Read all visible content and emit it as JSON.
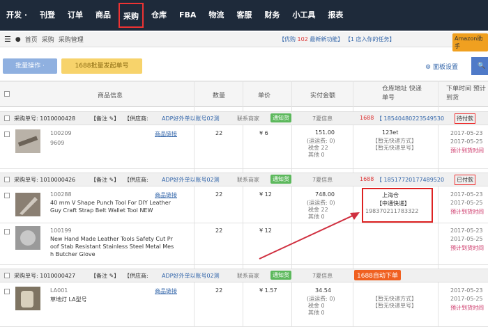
{
  "nav": {
    "items": [
      "开发 ·",
      "刊登",
      "订单",
      "商品",
      "采购",
      "仓库",
      "FBA",
      "物流",
      "客服",
      "财务",
      "小工具",
      "报表"
    ],
    "active": 4
  },
  "crumbs": [
    "首页",
    "采购",
    "采购管理"
  ],
  "notice": {
    "prefix": "【优购",
    "count": "102",
    "suffix": "最新新功能】 【1 店入你的任务】"
  },
  "amazon": "Amazon助手",
  "toolbar": {
    "batch": "批量操作 ·",
    "yellow": "1688批量发起单号",
    "settings": "面板设置"
  },
  "table": {
    "headers": [
      "商品信息",
      "数量",
      "单价",
      "实付金额",
      "仓库地址 快递单号",
      "下单时间 预计到货"
    ]
  },
  "orders": [
    {
      "po": "采购单号: 1010000428",
      "remark": "【备注 ✎】",
      "supplier": "【供应商: ",
      "supplier_name": "ADP好外单以账号02测",
      "contact": "联系商家",
      "label": "通知货",
      "price_label": "7夏信息",
      "src": "1688",
      "tracking": "【 18540480223549530",
      "status": "待付款"
    },
    {
      "po": "采购单号: 1010000426",
      "remark": "【备注 ✎】",
      "supplier": "【供应商: ",
      "supplier_name": "ADP好外单以账号02测",
      "contact": "联系商家",
      "label": "通知货",
      "price_label": "7夏信息",
      "src": "1688",
      "tracking": "【 18517720177489520",
      "status": "已付款"
    },
    {
      "po": "采购单号: 1010000427",
      "remark": "【备注 ✎】",
      "supplier": "【供应商: ",
      "supplier_name": "ADP好外单以账号02测",
      "contact": "联系商家",
      "label": "通知货",
      "price_label": "7夏信息",
      "orange": "1688自动下单"
    }
  ],
  "items": [
    {
      "sku": "100209",
      "name": "9609",
      "link": "商品链接",
      "qty": "22",
      "price": "¥ 6",
      "total": "151.00",
      "ship": "(运运费: 0)",
      "tax": "税金 22",
      "other": "其他 0",
      "addr": "123et",
      "addr2": "【暂无快递方式】",
      "addr3": "【暂无快递单号】",
      "date": "2017-05-23",
      "date2": "2017-05-25",
      "date3": "预计到货时间"
    },
    {
      "sku": "100288",
      "name": "40 mm V Shape Punch Tool For DIY Leather",
      "name2": "Guy Craft Strap Belt Wallet Tool NEW",
      "link": "商品链接",
      "qty": "22",
      "price": "¥ 12",
      "total": "748.00",
      "ship": "(运运费: 0)",
      "tax": "税金 22",
      "other": "其他 0",
      "addr": "上海仓",
      "addr2": "【中通快递】",
      "addr3": "198370211783322",
      "date": "2017-05-23",
      "date2": "2017-05-25",
      "date3": "预计到货时间"
    },
    {
      "sku": "100199",
      "name": "New Hand Made Leather Tools Safety Cut Pr",
      "name2": "oof Stab Resistant Stainless Steel Metal Mes",
      "name3": "h Butcher Glove",
      "qty": "22",
      "price": "¥ 12",
      "date": "2017-05-23",
      "date2": "2017-05-25",
      "date3": "预计到货时间"
    },
    {
      "sku": "LA001",
      "name": "草地灯 LA型号",
      "link": "商品链接",
      "qty": "22",
      "price": "¥ 1.57",
      "total": "34.54",
      "ship": "(运运费: 0)",
      "tax": "税金 0",
      "other": "其他 0",
      "addr2": "【暂无快递方式】",
      "addr3": "【暂无快递单号】",
      "date": "2017-05-23",
      "date2": "2017-05-25",
      "date3": "预计到货时间"
    }
  ]
}
